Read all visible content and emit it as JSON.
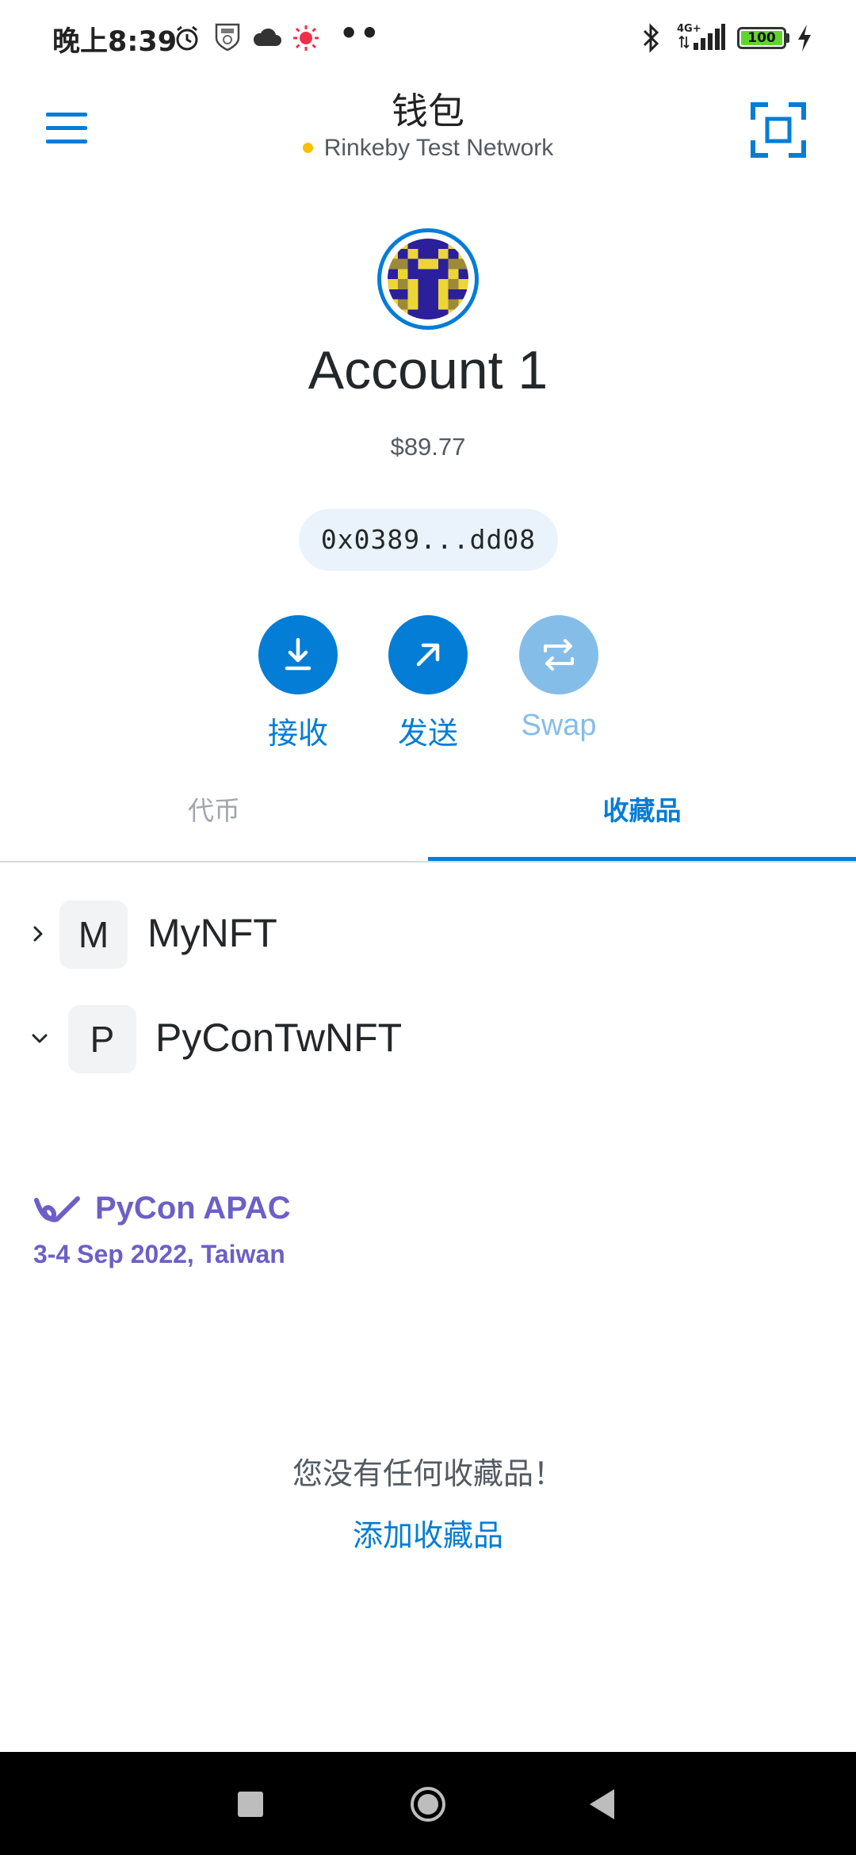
{
  "status_bar": {
    "time": "晚上8:39",
    "dots": "••",
    "network_type": "4G+",
    "battery": "100",
    "icons": [
      "alarm-icon",
      "shield-badge-icon",
      "cloud-icon",
      "sun-icon",
      "bluetooth-icon",
      "signal-icon",
      "charging-icon"
    ]
  },
  "header": {
    "title": "钱包",
    "network": "Rinkeby Test Network",
    "network_dot_color": "#f8c000"
  },
  "account": {
    "name": "Account 1",
    "balance": "$89.77",
    "address": "0x0389...dd08"
  },
  "actions": [
    {
      "label": "接收",
      "icon": "receive-icon",
      "enabled": true
    },
    {
      "label": "发送",
      "icon": "send-icon",
      "enabled": true
    },
    {
      "label": "Swap",
      "icon": "swap-icon",
      "enabled": false
    }
  ],
  "tabs": [
    {
      "label": "代币",
      "active": false
    },
    {
      "label": "收藏品",
      "active": true
    }
  ],
  "collections": [
    {
      "badge": "M",
      "name": "MyNFT",
      "expanded": false
    },
    {
      "badge": "P",
      "name": "PyConTwNFT",
      "expanded": true
    }
  ],
  "nft_item": {
    "title": "PyCon APAC",
    "subtitle": "3-4 Sep 2022, Taiwan"
  },
  "empty_state": {
    "message": "您没有任何收藏品！",
    "link": "添加收藏品"
  },
  "colors": {
    "accent": "#037dd6",
    "accent_disabled": "#85bde9",
    "pycon": "#6c5fc7"
  }
}
